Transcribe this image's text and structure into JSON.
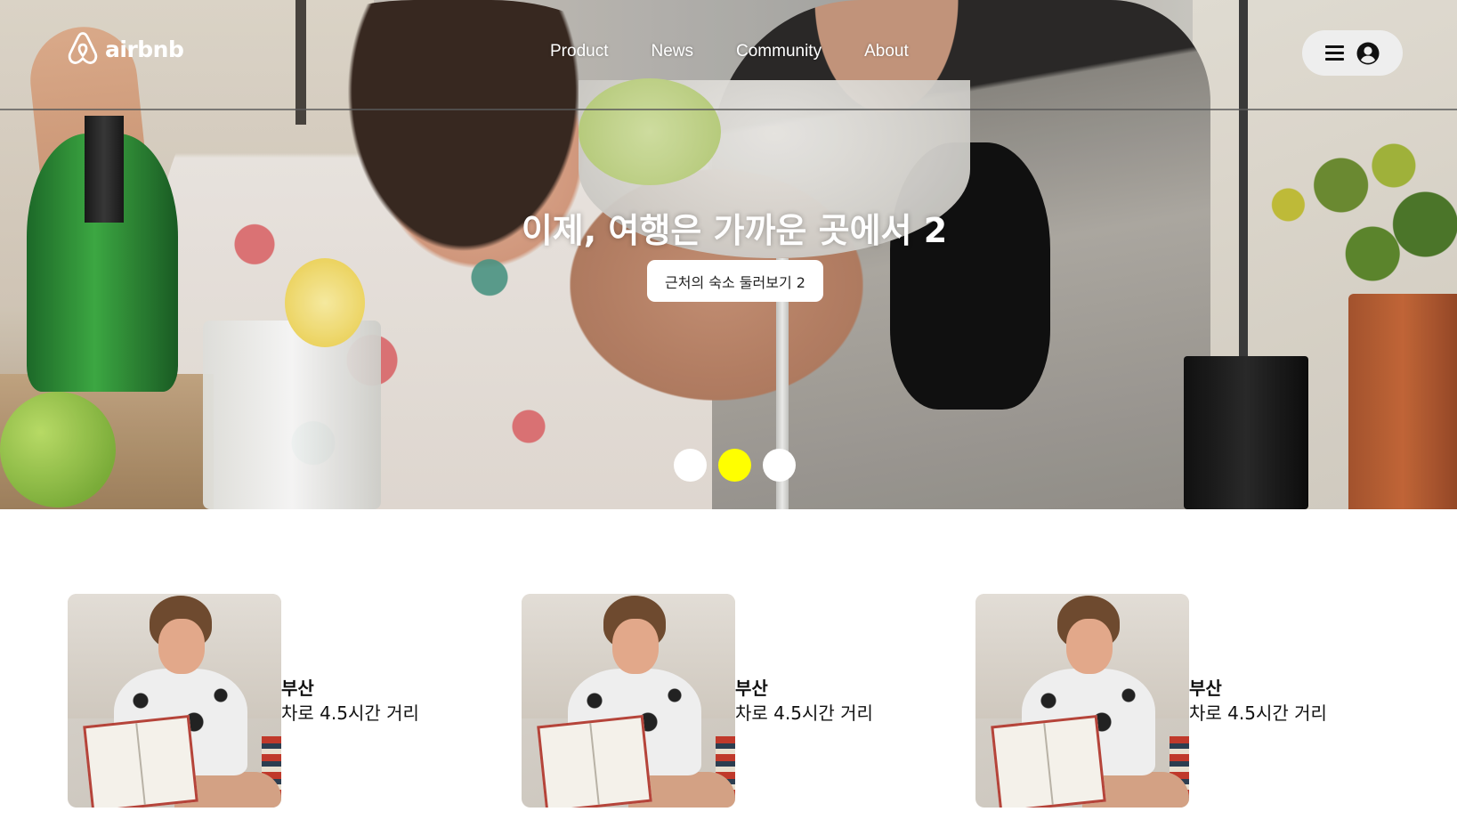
{
  "brand": {
    "name": "airbnb",
    "logo_icon": "airbnb-belo-icon"
  },
  "nav": {
    "items": [
      {
        "label": "Product"
      },
      {
        "label": "News"
      },
      {
        "label": "Community"
      },
      {
        "label": "About"
      }
    ]
  },
  "user_menu": {
    "icons": [
      "hamburger-menu-icon",
      "user-circle-icon"
    ]
  },
  "hero": {
    "title": "이제, 여행은 가까운 곳에서 2",
    "button_label": "근처의 숙소 둘러보기 2",
    "slides": {
      "count": 3,
      "active_index": 1
    },
    "colors": {
      "active_dot": "#ffff00",
      "inactive_dot": "#ffffff"
    }
  },
  "cards": [
    {
      "city": "부산",
      "distance": "차로 4.5시간 거리"
    },
    {
      "city": "부산",
      "distance": "차로 4.5시간 거리"
    },
    {
      "city": "부산",
      "distance": "차로 4.5시간 거리"
    }
  ]
}
